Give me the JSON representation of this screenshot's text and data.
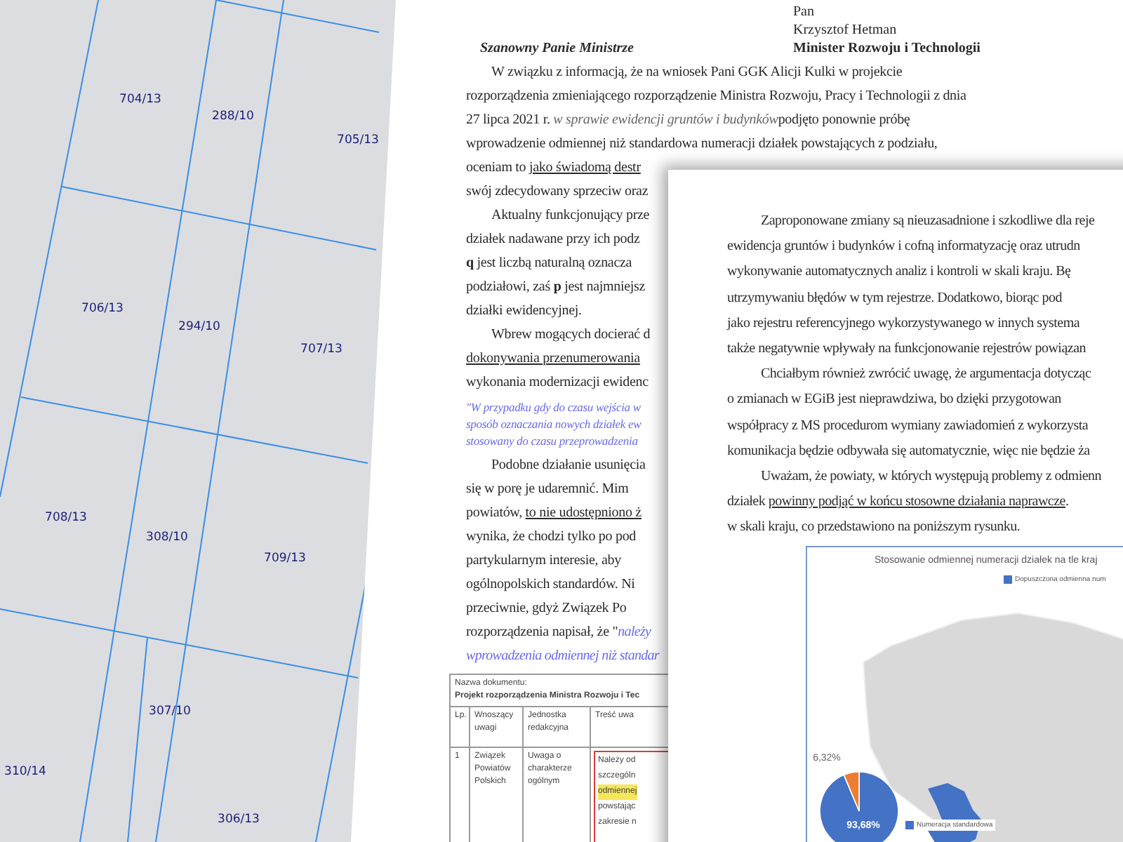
{
  "map": {
    "parcels": [
      {
        "label": "704/13"
      },
      {
        "label": "288/10"
      },
      {
        "label": "705/13"
      },
      {
        "label": "706/13"
      },
      {
        "label": "294/10"
      },
      {
        "label": "707/13"
      },
      {
        "label": "708/13"
      },
      {
        "label": "308/10"
      },
      {
        "label": "709/13"
      },
      {
        "label": "307/10"
      },
      {
        "label": "310/14"
      },
      {
        "label": "306/13"
      }
    ]
  },
  "letter": {
    "recipient": [
      {
        "text": "Pan",
        "bold": false
      },
      {
        "text": "Krzysztof Hetman",
        "bold": false
      },
      {
        "text": "Minister Rozwoju i Technologii",
        "bold": true
      }
    ],
    "salutation": "Szanowny Panie Ministrze",
    "paragraphs": [
      {
        "kind": "body",
        "lines": [
          [
            {
              "text": "W związku z informacją, że na wniosek Pani GGK Alicji Kulki w projekcie",
              "kind": "plain"
            }
          ],
          [
            {
              "text": "rozporządzenia zmieniającego rozporządzenie Ministra Rozwoju, Pracy i Technologii z dnia",
              "kind": "plain"
            }
          ],
          [
            {
              "text": "27 lipca 2021 r. ",
              "kind": "plain"
            },
            {
              "text": "w sprawie ewidencji gruntów i budynków",
              "kind": "emphasis"
            },
            {
              "text": "podjęto ponownie próbę",
              "kind": "plain"
            }
          ],
          [
            {
              "text": "wprowadzenie odmiennej niż standardowa numeracji działek powstających z podziału,",
              "kind": "plain"
            }
          ],
          [
            {
              "text": "oceniam to ",
              "kind": "plain"
            },
            {
              "text": "jako świadomą destr",
              "kind": "underlined"
            }
          ],
          [
            {
              "text": "swój zdecydowany sprzeciw oraz",
              "kind": "plain"
            }
          ]
        ]
      },
      {
        "kind": "body",
        "lines": [
          [
            {
              "text": "Aktualny funkcjonujący prze",
              "kind": "plain"
            }
          ],
          [
            {
              "text": "działek nadawane przy ich podz",
              "kind": "plain"
            }
          ],
          [
            {
              "text": "q",
              "kind": "strong"
            },
            {
              "text": " jest liczbą naturalną oznacza",
              "kind": "plain"
            }
          ],
          [
            {
              "text": "podziałowi, zaś ",
              "kind": "plain"
            },
            {
              "text": "p",
              "kind": "strong"
            },
            {
              "text": " jest najmniejsz",
              "kind": "plain"
            }
          ],
          [
            {
              "text": "działki ewidencyjnej.",
              "kind": "plain"
            }
          ]
        ]
      },
      {
        "kind": "body",
        "lines": [
          [
            {
              "text": "Wbrew mogących docierać d",
              "kind": "plain"
            }
          ],
          [
            {
              "text": "dokonywania przenumerowania",
              "kind": "underlined"
            }
          ],
          [
            {
              "text": "wykonania modernizacji ewidenc",
              "kind": "plain"
            }
          ]
        ]
      },
      {
        "kind": "quote",
        "lines": [
          [
            {
              "text": "\"W przypadku gdy do czasu wejścia w",
              "kind": "plain"
            }
          ],
          [
            {
              "text": "sposób oznaczania nowych działek ew",
              "kind": "plain"
            }
          ],
          [
            {
              "text": "stosowany do czasu przeprowadzenia",
              "kind": "plain"
            }
          ]
        ]
      },
      {
        "kind": "body",
        "lines": [
          [
            {
              "text": "Podobne działanie usunięcia",
              "kind": "plain"
            }
          ],
          [
            {
              "text": "się w porę je udaremnić. Mim",
              "kind": "plain"
            }
          ],
          [
            {
              "text": "powiatów, ",
              "kind": "plain"
            },
            {
              "text": "to nie udostępniono ż",
              "kind": "underlined"
            }
          ],
          [
            {
              "text": "wynika, że chodzi tylko po pod",
              "kind": "plain"
            }
          ],
          [
            {
              "text": "partykularnym interesie, aby",
              "kind": "plain"
            }
          ],
          [
            {
              "text": "ogólnopolskich standardów. Ni",
              "kind": "plain"
            }
          ],
          [
            {
              "text": "przeciwnie, gdyż Związek Po",
              "kind": "plain"
            }
          ],
          [
            {
              "text": "rozporządzenia napisał, że \"",
              "kind": "plain"
            },
            {
              "text": "należy",
              "kind": "quote"
            }
          ],
          [
            {
              "text": "wprowadzenia odmiennej niż standar",
              "kind": "quote"
            }
          ]
        ]
      }
    ],
    "table": {
      "caption": "Nazwa dokumentu:",
      "document": "Projekt rozporządzenia Ministra Rozwoju i Tec",
      "columns": [
        "Lp.",
        "Wnoszący uwagi",
        "Jednostka redakcyjna",
        "Treść uwa"
      ],
      "row": {
        "cells": [
          "1",
          "Związek Powiatów Polskich",
          "Uwaga o charakterze ogólnym"
        ],
        "comment": {
          "flagged": true,
          "lines": [
            {
              "text": "Należy od",
              "highlighted": false
            },
            {
              "text": "szczególn",
              "highlighted": false
            },
            {
              "text": "odmiennej",
              "highlighted": true
            },
            {
              "text": "powstając",
              "highlighted": false
            },
            {
              "text": "zakresie n",
              "highlighted": false
            }
          ]
        }
      }
    }
  },
  "page_2": {
    "paragraphs": [
      {
        "kind": "body",
        "lines": [
          [
            {
              "text": "Zaproponowane zmiany są nieuzasadnione i szkodliwe dla reje",
              "kind": "plain"
            }
          ],
          [
            {
              "text": "ewidencja gruntów i budynków i cofną informatyzację oraz utrudn",
              "kind": "plain"
            }
          ],
          [
            {
              "text": "wykonywanie automatycznych analiz i kontroli w skali kraju. Bę",
              "kind": "plain"
            }
          ],
          [
            {
              "text": "utrzymywaniu błędów w tym rejestrze. Dodatkowo, biorąc pod",
              "kind": "plain"
            }
          ],
          [
            {
              "text": "jako rejestru referencyjnego wykorzystywanego w innych systema",
              "kind": "plain"
            }
          ],
          [
            {
              "text": "także negatywnie wpływały na funkcjonowanie rejestrów powiązan",
              "kind": "plain"
            }
          ]
        ]
      },
      {
        "kind": "body",
        "lines": [
          [
            {
              "text": "Chciałbym również zwrócić uwagę, że argumentacja dotycząc",
              "kind": "plain"
            }
          ],
          [
            {
              "text": "o zmianach w EGiB jest nieprawdziwa, bo dzięki przygotowan",
              "kind": "plain"
            }
          ],
          [
            {
              "text": "współpracy z MS procedurom wymiany zawiadomień z wykorzysta",
              "kind": "plain"
            }
          ],
          [
            {
              "text": "komunikacja będzie odbywała się automatycznie, więc nie będzie ża",
              "kind": "plain"
            }
          ]
        ]
      },
      {
        "kind": "body",
        "lines": [
          [
            {
              "text": "Uważam, że powiaty, w których występują problemy z odmienn",
              "kind": "plain"
            }
          ],
          [
            {
              "text": "działek ",
              "kind": "plain"
            },
            {
              "text": "powinny podjąć w końcu stosowne działania naprawcze",
              "kind": "underlined"
            },
            {
              "text": ".",
              "kind": "plain"
            }
          ],
          [
            {
              "text": "w skali kraju, co przedstawiono na poniższym rysunku.",
              "kind": "plain"
            }
          ]
        ]
      }
    ],
    "figure": {
      "title": "Stosowanie odmiennej numeracji działek na tle kraj",
      "map_legend": "Dopuszczona odmienna num",
      "pie_legend": "Numeracja standardowa",
      "chart_data": {
        "type": "pie",
        "values": [
          93.68,
          6.32
        ],
        "value_labels": [
          "93,68%",
          "6,32%"
        ]
      }
    }
  }
}
